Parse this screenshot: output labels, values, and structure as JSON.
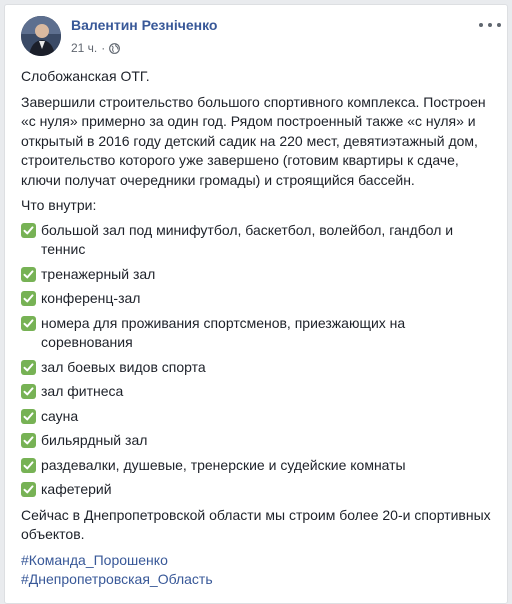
{
  "post": {
    "author": "Валентин Резніченко",
    "time": "21 ч.",
    "separator": "·",
    "privacy_icon": "globe-icon",
    "more_icon": "more-options-icon",
    "intro": "Слобожанская ОТГ.",
    "body": "Завершили строительство большого спортивного комплекса. Построен «с нуля» примерно за один год. Рядом построенный также «с нуля» и открытый в 2016 году детский садик на 220 мест, девятиэтажный дом, строительство которого уже завершено (готовим квартиры к сдаче, ключи получат очередники громады) и строящийся бассейн.",
    "list_heading": "Что внутри:",
    "check_icon": "check-mark-emoji-icon",
    "check_color": "#77b255",
    "items": [
      "большой зал под минифутбол, баскетбол, волейбол, гандбол и теннис",
      "тренажерный зал",
      "конференц-зал",
      "номера для проживания спортсменов, приезжающих на соревнования",
      "зал боевых видов спорта",
      "зал фитнеса",
      "сауна",
      "бильярдный зал",
      "раздевалки, душевые, тренерские и судейские комнаты",
      "кафетерий"
    ],
    "closing": "Сейчас в Днепропетровской области мы строим более 20-и спортивных объектов.",
    "hashtags": [
      "#Команда_Порошенко",
      "#Днепропетровская_Область"
    ],
    "colors": {
      "link": "#385898",
      "text": "#1d2129",
      "meta": "#616770",
      "page_bg": "#e9ebee"
    }
  }
}
